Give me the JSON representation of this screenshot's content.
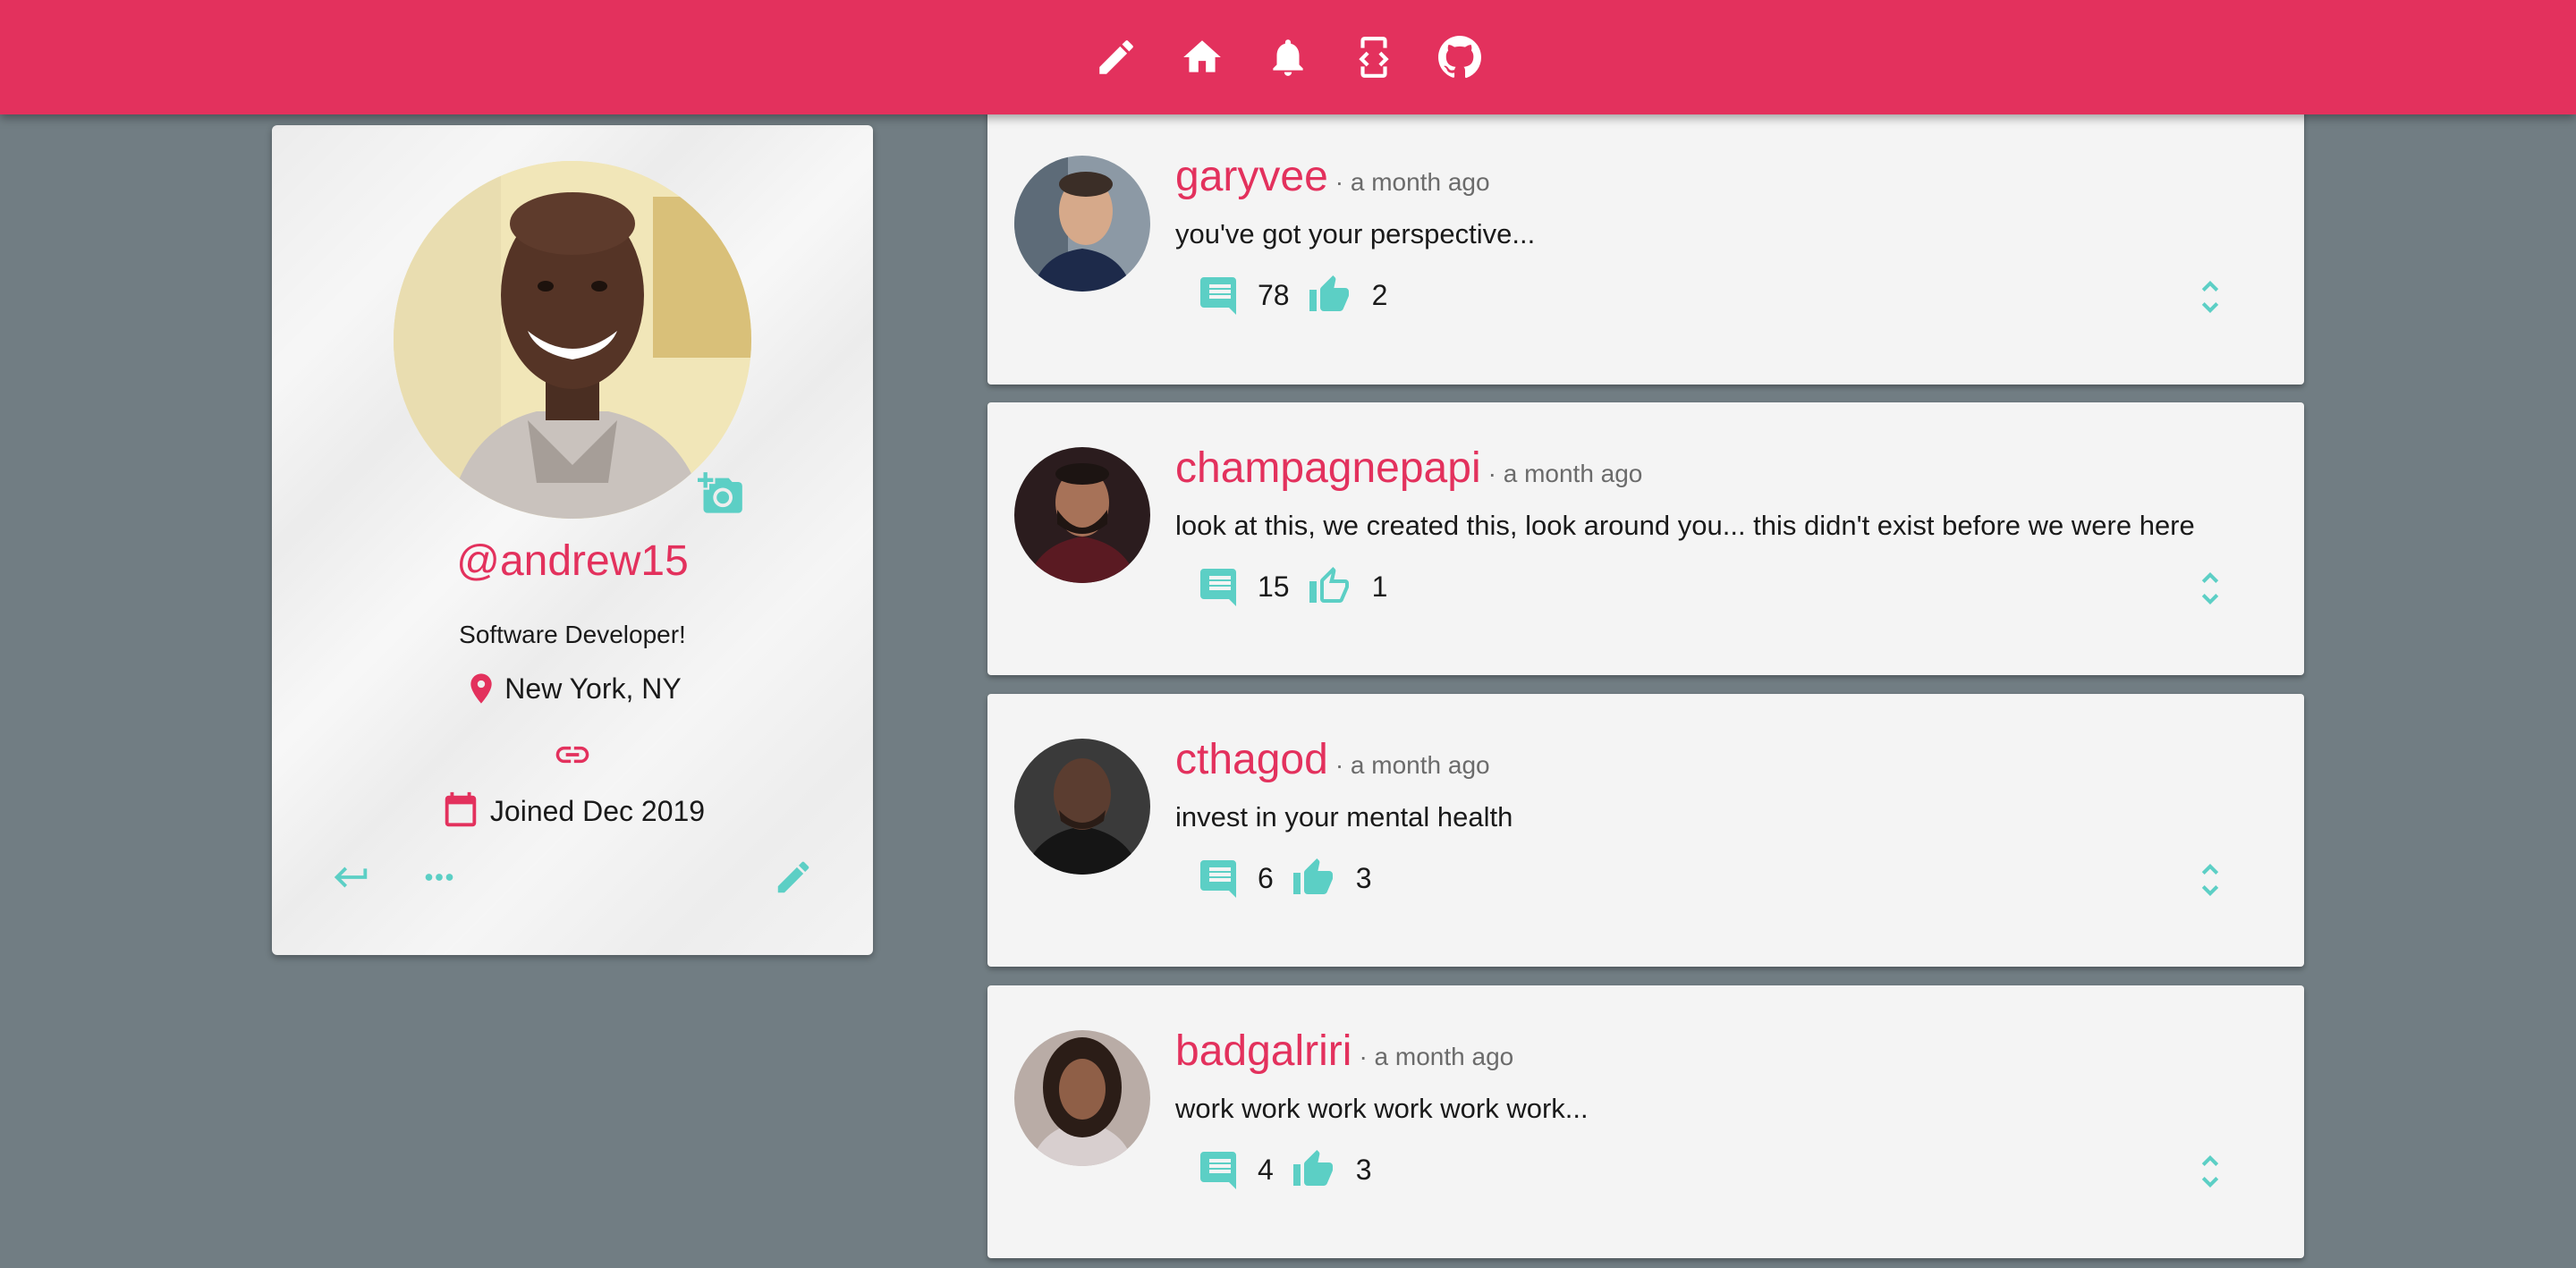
{
  "navbar": {
    "icons": [
      "pencil-icon",
      "home-icon",
      "bell-icon",
      "code-icon",
      "github-icon"
    ],
    "color": "#e3315d"
  },
  "profile": {
    "handle": "@andrew15",
    "bio": "Software Developer!",
    "location": "New York, NY",
    "joined": "Joined Dec 2019",
    "accent": "#e3315d",
    "icon_color": "#5ccfc5"
  },
  "posts": [
    {
      "user": "garyvee",
      "time": "· a month ago",
      "body": "you've got your perspective...",
      "comments": "78",
      "likes": "2",
      "liked": true
    },
    {
      "user": "champagnepapi",
      "time": "· a month ago",
      "body": "look at this, we created this, look around you... this didn't exist before we were here",
      "comments": "15",
      "likes": "1",
      "liked": false
    },
    {
      "user": "cthagod",
      "time": "· a month ago",
      "body": "invest in your mental health",
      "comments": "6",
      "likes": "3",
      "liked": true
    },
    {
      "user": "badgalriri",
      "time": "· a month ago",
      "body": "work work work work work work...",
      "comments": "4",
      "likes": "3",
      "liked": true
    }
  ]
}
